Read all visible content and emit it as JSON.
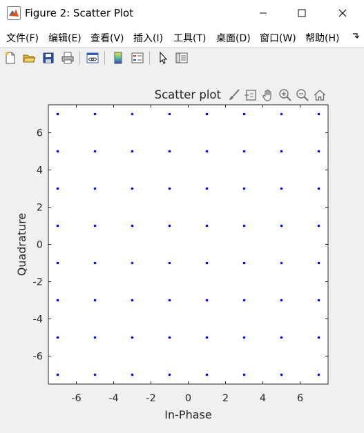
{
  "window": {
    "title": "Figure 2: Scatter Plot",
    "minimize_icon": "minimize-icon",
    "maximize_icon": "maximize-icon",
    "close_icon": "close-icon"
  },
  "menu": {
    "items": [
      "文件(F)",
      "编辑(E)",
      "查看(V)",
      "插入(I)",
      "工具(T)",
      "桌面(D)",
      "窗口(W)",
      "帮助(H)"
    ]
  },
  "toolbar": {
    "icons": [
      "new-figure-icon",
      "open-file-icon",
      "save-icon",
      "print-icon",
      "link-plot-icon",
      "insert-colorbar-icon",
      "insert-legend-icon",
      "edit-plot-pointer-icon",
      "property-inspector-icon"
    ]
  },
  "axes_toolbar": {
    "icons": [
      "brush-icon",
      "data-tips-icon",
      "pan-icon",
      "zoom-in-icon",
      "zoom-out-icon",
      "restore-view-icon"
    ]
  },
  "colors": {
    "marker": "#0000ff",
    "axes_bg": "#ffffff",
    "figure_bg": "#f0f0f0",
    "text": "#262626"
  },
  "chart_data": {
    "type": "scatter",
    "title": "Scatter plot",
    "xlabel": "In-Phase",
    "ylabel": "Quadrature",
    "xlim": [
      -7.5,
      7.5
    ],
    "ylim": [
      -7.5,
      7.5
    ],
    "xticks": [
      -6,
      -4,
      -2,
      0,
      2,
      4,
      6
    ],
    "yticks": [
      -6,
      -4,
      -2,
      0,
      2,
      4,
      6
    ],
    "grid": false,
    "series": [
      {
        "x": [
          -7,
          -5,
          -3,
          -1,
          1,
          3,
          5,
          7
        ],
        "y": [
          -7,
          -5,
          -3,
          -1,
          1,
          3,
          5,
          7
        ],
        "layout": "grid"
      }
    ]
  }
}
